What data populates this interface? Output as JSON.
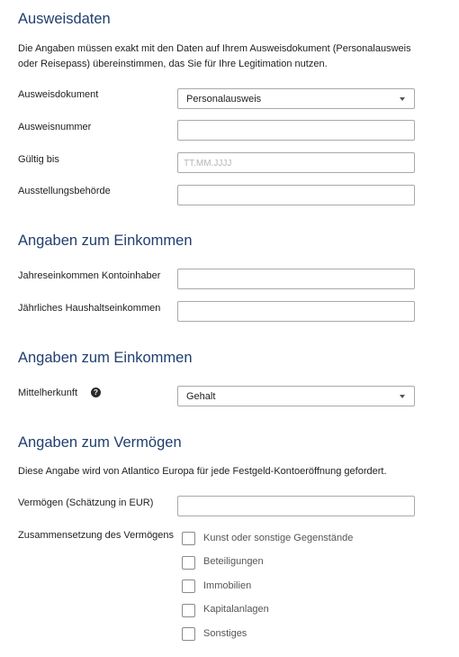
{
  "section1": {
    "title": "Ausweisdaten",
    "intro_line1": "Die Angaben müssen exakt mit den Daten auf Ihrem Ausweisdokument (Personalausweis",
    "intro_line2": "oder Reisepass) übereinstimmen, das Sie für Ihre Legitimation nutzen.",
    "doc_label": "Ausweisdokument",
    "doc_value": "Personalausweis",
    "number_label": "Ausweisnummer",
    "number_value": "",
    "valid_label": "Gültig bis",
    "valid_placeholder": "TT.MM.JJJJ",
    "authority_label": "Ausstellungsbehörde",
    "authority_value": ""
  },
  "section2": {
    "title": "Angaben zum Einkommen",
    "annual_label": "Jahreseinkommen Kontoinhaber",
    "annual_value": "",
    "household_label": "Jährliches Haushaltseinkommen",
    "household_value": ""
  },
  "section3": {
    "title": "Angaben zum Einkommen",
    "source_label": "Mittelherkunft",
    "help_glyph": "?",
    "source_value": "Gehalt"
  },
  "section4": {
    "title": "Angaben zum Vermögen",
    "intro": "Diese Angabe wird von Atlantico Europa für jede Festgeld-Kontoeröffnung gefordert.",
    "wealth_label": "Vermögen (Schätzung in EUR)",
    "wealth_value": "",
    "composition_label": "Zusammensetzung des Vermögens",
    "options": [
      "Kunst oder sonstige Gegenstände",
      "Beteiligungen",
      "Immobilien",
      "Kapitalanlagen",
      "Sonstiges"
    ]
  },
  "colors": {
    "heading": "#1f3f6e",
    "border": "#a9a9a9",
    "placeholder": "#b4b4b4"
  }
}
